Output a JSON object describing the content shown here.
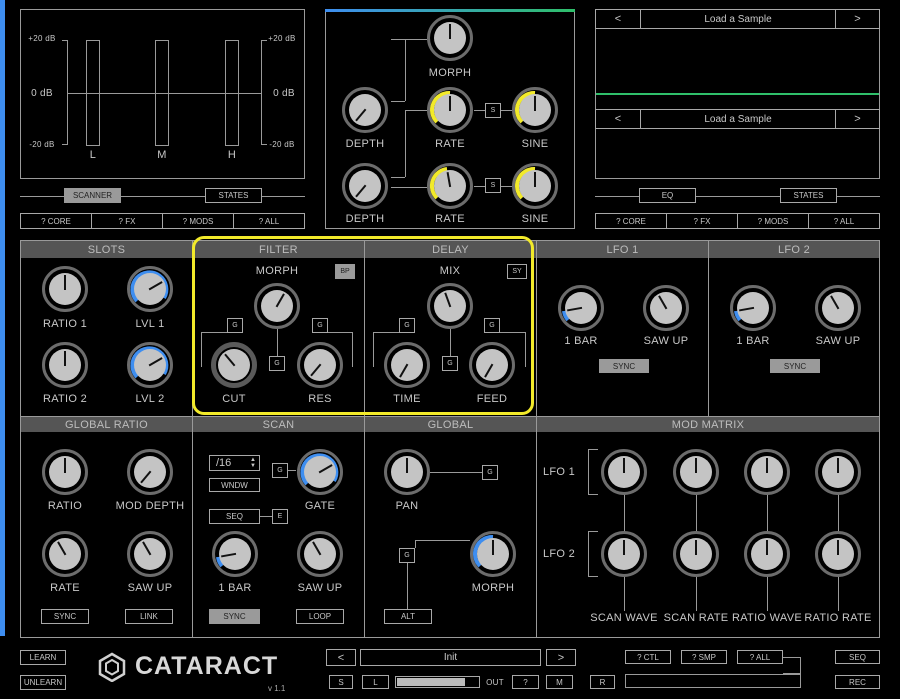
{
  "app": {
    "name": "CATARACT",
    "version": "v 1.1"
  },
  "colors": {
    "accent_blue": "#3e8ef0",
    "accent_yellow": "#f2ea2a",
    "accent_green": "#2fbf6a",
    "knob_face": "#c4c4c4"
  },
  "meter": {
    "left_scale": [
      "+20 dB",
      "0 dB",
      "-20 dB"
    ],
    "right_scale": [
      "+20 dB",
      "0 dB",
      "-20 dB"
    ],
    "bars": [
      "L",
      "M",
      "H"
    ],
    "tabs": [
      "SCANNER",
      "STATES"
    ],
    "subtabs": [
      "? CORE",
      "? FX",
      "? MODS",
      "? ALL"
    ]
  },
  "mod_panel": {
    "morph": "MORPH",
    "row1": {
      "depth": "DEPTH",
      "rate": "RATE",
      "shape": "SINE",
      "s": "S"
    },
    "row2": {
      "depth": "DEPTH",
      "rate": "RATE",
      "shape": "SINE",
      "s": "S"
    }
  },
  "sampler": {
    "slot1": {
      "prev": "<",
      "name": "Load a Sample",
      "next": ">"
    },
    "slot2": {
      "prev": "<",
      "name": "Load a Sample",
      "next": ">"
    },
    "tabs": [
      "EQ",
      "STATES"
    ],
    "subtabs": [
      "? CORE",
      "? FX",
      "? MODS",
      "? ALL"
    ]
  },
  "slots": {
    "title": "SLOTS",
    "k1": "RATIO 1",
    "k2": "LVL 1",
    "k3": "RATIO 2",
    "k4": "LVL 2"
  },
  "filter": {
    "title": "FILTER",
    "morph": "MORPH",
    "mode": "BP",
    "cut": "CUT",
    "res": "RES",
    "g": "G"
  },
  "delay": {
    "title": "DELAY",
    "mix": "MIX",
    "mode": "SY",
    "time": "TIME",
    "feed": "FEED",
    "g": "G"
  },
  "lfo1": {
    "title": "LFO 1",
    "k1": "1 BAR",
    "k2": "SAW UP",
    "sync": "SYNC"
  },
  "lfo2": {
    "title": "LFO 2",
    "k1": "1 BAR",
    "k2": "SAW UP",
    "sync": "SYNC"
  },
  "global_ratio": {
    "title": "GLOBAL RATIO",
    "k1": "RATIO",
    "k2": "MOD DEPTH",
    "k3": "RATE",
    "k4": "SAW UP",
    "sync": "SYNC",
    "link": "LINK"
  },
  "scan": {
    "title": "SCAN",
    "division": "/16",
    "wndw": "WNDW",
    "seq": "SEQ",
    "e": "E",
    "g": "G",
    "gate": "GATE",
    "k1": "1 BAR",
    "k2": "SAW UP",
    "sync": "SYNC",
    "loop": "LOOP"
  },
  "global": {
    "title": "GLOBAL",
    "pan": "PAN",
    "morph": "MORPH",
    "alt": "ALT",
    "g": "G"
  },
  "mod_matrix": {
    "title": "MOD MATRIX",
    "lfo1": "LFO 1",
    "lfo2": "LFO 2",
    "cols": [
      "SCAN WAVE",
      "SCAN RATE",
      "RATIO WAVE",
      "RATIO RATE"
    ]
  },
  "footer": {
    "learn": "LEARN",
    "unlearn": "UNLEARN",
    "prev": "<",
    "preset": "Init",
    "next": ">",
    "s": "S",
    "l": "L",
    "out": "OUT",
    "q": "?",
    "m": "M",
    "r": "R",
    "ctl": "? CTL",
    "smp": "? SMP",
    "all": "? ALL",
    "seq": "SEQ",
    "rec": "REC"
  }
}
